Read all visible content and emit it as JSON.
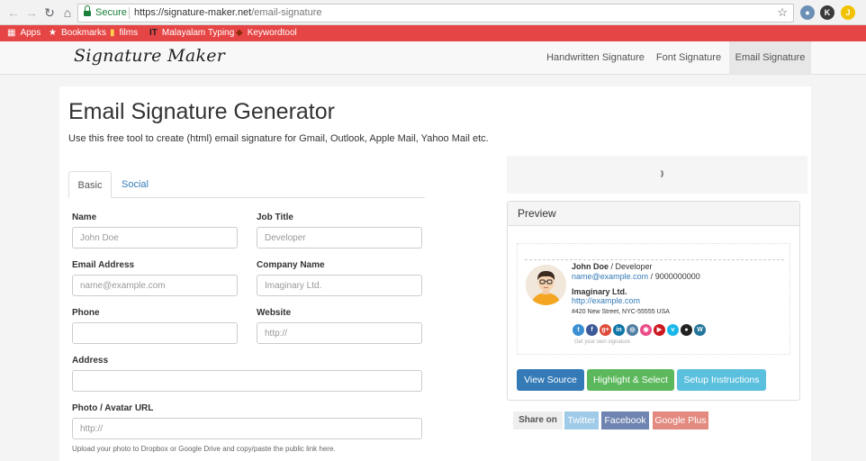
{
  "browser": {
    "secure_label": "Secure",
    "url_host": "https://signature-maker.net",
    "url_path": "/email-signature",
    "extensions": [
      {
        "name": "ext-globe",
        "letter": "",
        "color": "#6b8fb5"
      },
      {
        "name": "ext-k",
        "letter": "K",
        "color": "#3a3a3a"
      },
      {
        "name": "ext-j",
        "letter": "J",
        "color": "#f2c200"
      }
    ]
  },
  "bookmarks": [
    {
      "label": "Apps",
      "icon": "apps-icon"
    },
    {
      "label": "Bookmarks",
      "icon": "star-icon"
    },
    {
      "label": "films",
      "icon": "folder-icon"
    },
    {
      "label": "Malayalam Typing",
      "icon": "typing-icon"
    },
    {
      "label": "Keywordtool",
      "icon": "key-icon"
    }
  ],
  "site_nav": {
    "brand": "Signature Maker",
    "links": [
      {
        "label": "Handwritten Signature",
        "active": false
      },
      {
        "label": "Font Signature",
        "active": false
      },
      {
        "label": "Email Signature",
        "active": true
      }
    ]
  },
  "main": {
    "title": "Email Signature Generator",
    "description": "Use this free tool to create (html) email signature for Gmail, Outlook, Apple Mail, Yahoo Mail etc.",
    "tabs": [
      {
        "label": "Basic",
        "active": true
      },
      {
        "label": "Social",
        "active": false
      }
    ]
  },
  "form": {
    "name": {
      "label": "Name",
      "value": "",
      "placeholder": "John Doe"
    },
    "job_title": {
      "label": "Job Title",
      "value": "",
      "placeholder": "Developer"
    },
    "email": {
      "label": "Email Address",
      "value": "",
      "placeholder": "name@example.com"
    },
    "company": {
      "label": "Company Name",
      "value": "",
      "placeholder": "Imaginary Ltd."
    },
    "phone": {
      "label": "Phone",
      "value": "",
      "placeholder": ""
    },
    "website": {
      "label": "Website",
      "value": "",
      "placeholder": "http://"
    },
    "address": {
      "label": "Address",
      "value": "",
      "placeholder": ""
    },
    "photo": {
      "label": "Photo / Avatar URL",
      "value": "",
      "placeholder": "http://"
    },
    "photo_help": "Upload your photo to Dropbox or Google Drive and copy/paste the public link here."
  },
  "preview": {
    "header": "Preview",
    "signature": {
      "name": "John Doe",
      "separator": " / ",
      "title": "Developer",
      "email": "name@example.com",
      "phone": "9000000000",
      "company": "Imaginary Ltd.",
      "url": "http://example.com",
      "address": "#420 New Street, NYC-55555 USA",
      "footer": "Get your own signature"
    },
    "socials": [
      {
        "name": "twitter-icon",
        "glyph": "t",
        "color": "#3b8ed1"
      },
      {
        "name": "facebook-icon",
        "glyph": "f",
        "color": "#3b5998"
      },
      {
        "name": "google-plus-icon",
        "glyph": "g+",
        "color": "#dd4b39"
      },
      {
        "name": "linkedin-icon",
        "glyph": "in",
        "color": "#0e76a8"
      },
      {
        "name": "instagram-icon",
        "glyph": "◎",
        "color": "#517fa4"
      },
      {
        "name": "dribbble-icon",
        "glyph": "◉",
        "color": "#ea4c89"
      },
      {
        "name": "youtube-icon",
        "glyph": "▶",
        "color": "#cc181e"
      },
      {
        "name": "vimeo-icon",
        "glyph": "v",
        "color": "#1ab7ea"
      },
      {
        "name": "github-icon",
        "glyph": "●",
        "color": "#222222"
      },
      {
        "name": "wordpress-icon",
        "glyph": "W",
        "color": "#21759b"
      }
    ],
    "buttons": {
      "view_source": "View Source",
      "highlight": "Highlight & Select",
      "setup": "Setup Instructions"
    }
  },
  "share": {
    "label": "Share on",
    "twitter": "Twitter",
    "facebook": "Facebook",
    "google_plus": "Google Plus"
  },
  "colors": {
    "bookmark_bar": "#e64545",
    "primary_button": "#337ab7",
    "success_button": "#5cb85c",
    "info_button": "#5bc0de",
    "twitter_share": "#9fcbe8",
    "facebook_share": "#6f84b0",
    "google_share": "#e38a80",
    "link": "#337ab7"
  }
}
